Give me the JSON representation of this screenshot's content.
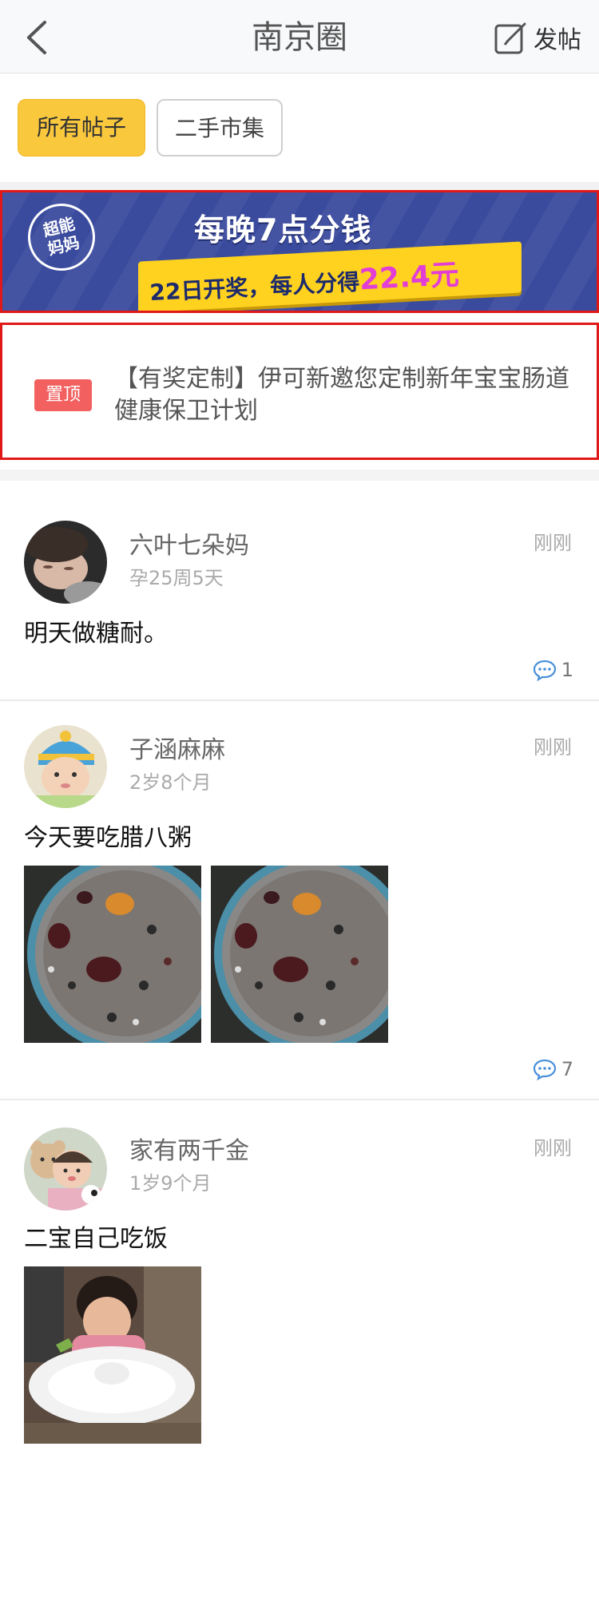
{
  "header": {
    "title": "南京圈",
    "post_label": "发帖"
  },
  "tabs": {
    "all": "所有帖子",
    "market": "二手市集"
  },
  "banner": {
    "badge_line1": "超能",
    "badge_line2": "妈妈",
    "headline": "每晚7点分钱",
    "subtitle": "22日开奖，每人分得",
    "amount": "22.4元"
  },
  "pinned": {
    "tag": "置顶",
    "title": "【有奖定制】伊可新邀您定制新年宝宝肠道健康保卫计划"
  },
  "posts": [
    {
      "name": "六叶七朵妈",
      "sub": "孕25周5天",
      "time": "刚刚",
      "text": "明天做糖耐。",
      "comments": "1"
    },
    {
      "name": "子涵麻麻",
      "sub": "2岁8个月",
      "time": "刚刚",
      "text": "今天要吃腊八粥",
      "comments": "7"
    },
    {
      "name": "家有两千金",
      "sub": "1岁9个月",
      "time": "刚刚",
      "text": "二宝自己吃饭"
    }
  ]
}
